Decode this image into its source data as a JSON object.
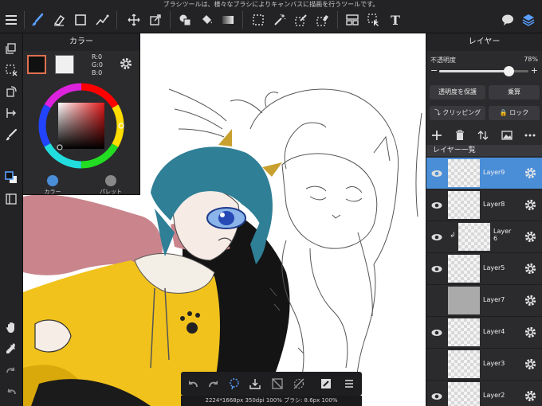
{
  "top_hint": "ブラシツールは、様々なブラシによりキャンバスに描画を行うツールです。",
  "toolbar": {
    "icons": [
      "menu-icon",
      "brush-icon",
      "eraser-icon",
      "rectangle-icon",
      "smudge-icon",
      "move-icon",
      "transform-icon",
      "fill-icon",
      "bucket-icon",
      "gradient-icon",
      "select-rect-icon",
      "magic-wand-icon",
      "select-pen-icon",
      "select-eraser-icon",
      "layout-icon",
      "select-move-icon",
      "text-icon",
      "chat-icon",
      "layers-icon"
    ],
    "text_tool_label": "T"
  },
  "color_panel": {
    "title": "カラー",
    "r": "R:0",
    "g": "G:0",
    "b": "B:0",
    "tab_color": "カラー",
    "tab_palette": "パレット",
    "main_color": "#111111",
    "sub_color": "#f0f0f0",
    "accent": "#4a8ed8"
  },
  "layer_panel": {
    "title": "レイヤー",
    "opacity_label": "不透明度",
    "opacity_value": "78%",
    "opacity_fraction": 0.78,
    "protect_alpha": "透明度を保護",
    "blend_mode": "乗算",
    "clipping": "クリッピング",
    "lock": "ロック",
    "list_title": "レイヤー一覧",
    "layers": [
      {
        "name": "Layer9",
        "visible": true,
        "selected": true
      },
      {
        "name": "Layer8",
        "visible": true,
        "selected": false
      },
      {
        "name": "Layer\n6",
        "visible": true,
        "selected": false,
        "clipped": true
      },
      {
        "name": "Layer5",
        "visible": true,
        "selected": false
      },
      {
        "name": "Layer7",
        "visible": false,
        "selected": false
      },
      {
        "name": "Layer4",
        "visible": true,
        "selected": false
      },
      {
        "name": "Layer3",
        "visible": false,
        "selected": false
      },
      {
        "name": "Layer2",
        "visible": true,
        "selected": false
      }
    ]
  },
  "status": "2224*1668px 350dpi 100% ブラシ: 8.6px 100%"
}
